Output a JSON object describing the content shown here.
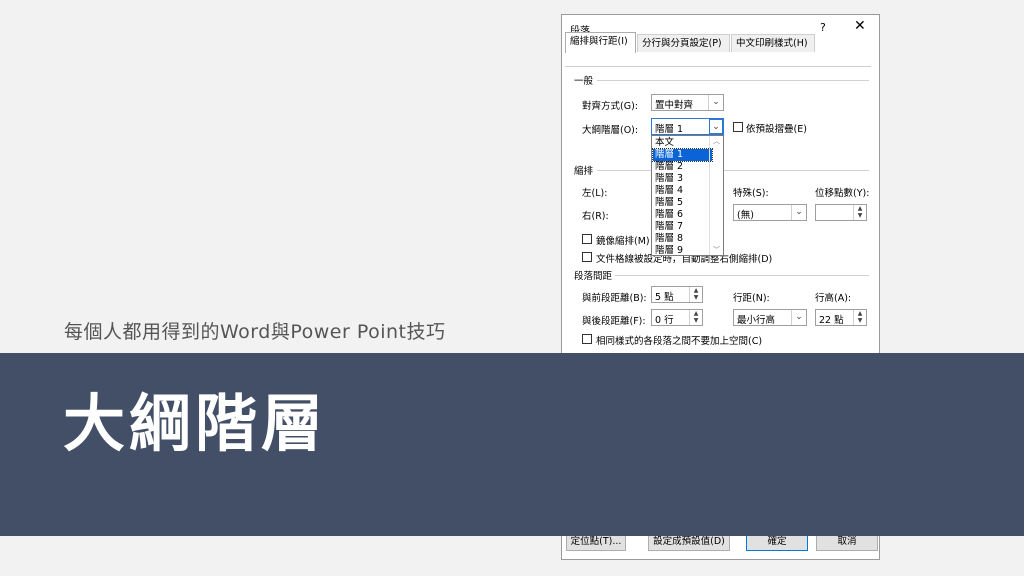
{
  "slide": {
    "subtitle": "每個人都用得到的Word與Power Point技巧",
    "title": "大綱階層",
    "banner_color": "#424f66"
  },
  "dialog": {
    "title": "段落",
    "help": "?",
    "close": "✕",
    "tabs": [
      "縮排與行距(I)",
      "分行與分頁設定(P)",
      "中文印刷樣式(H)"
    ],
    "general": {
      "section": "一般",
      "alignment_label": "對齊方式(G):",
      "alignment_value": "置中對齊",
      "outline_label": "大綱階層(O):",
      "outline_value": "階層 1",
      "collapse_label": "依預設摺疊(E)"
    },
    "outline_options": [
      "本文",
      "階層 1",
      "階層 2",
      "階層 3",
      "階層 4",
      "階層 5",
      "階層 6",
      "階層 7",
      "階層 8",
      "階層 9"
    ],
    "indent": {
      "section": "縮排",
      "left_label": "左(L):",
      "right_label": "右(R):",
      "special_label": "特殊(S):",
      "special_value": "(無)",
      "by_label": "位移點數(Y):",
      "mirror_label": "鏡像縮排(M)",
      "grid_label": "文件格線被設定時，自動調整右側縮排(D)"
    },
    "spacing": {
      "section": "段落間距",
      "before_label": "與前段距離(B):",
      "before_value": "5 點",
      "after_label": "與後段距離(F):",
      "after_value": "0 行",
      "line_label": "行距(N):",
      "line_value": "最小行高",
      "at_label": "行高(A):",
      "at_value": "22 點",
      "no_space_label": "相同樣式的各段落之間不要加上空間(C)"
    },
    "buttons": {
      "tabs": "定位點(T)...",
      "default": "設定成預設值(D)",
      "ok": "確定",
      "cancel": "取消"
    }
  }
}
